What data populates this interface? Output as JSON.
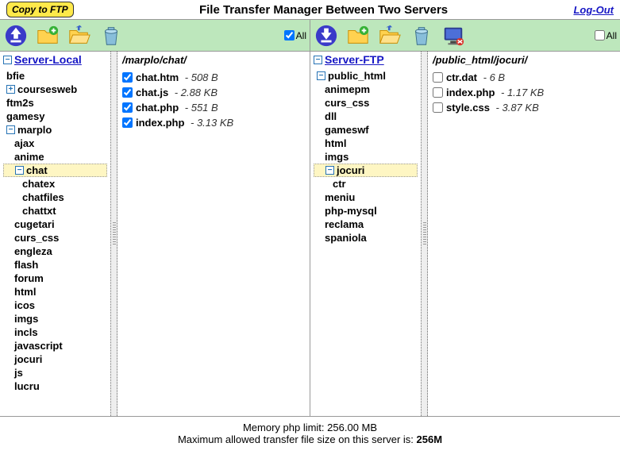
{
  "header": {
    "copy_label": "Copy to FTP",
    "title": "File Transfer Manager Between Two Servers",
    "logout": "Log-Out"
  },
  "all_label": "All",
  "panels": {
    "local": {
      "server_link": "Server-Local",
      "path": "/marplo/chat/",
      "all_checked": true,
      "tree": [
        {
          "label": "bfie",
          "lvl": 1,
          "t": null
        },
        {
          "label": "coursesweb",
          "lvl": 1,
          "t": "+"
        },
        {
          "label": "ftm2s",
          "lvl": 1,
          "t": null
        },
        {
          "label": "gamesy",
          "lvl": 1,
          "t": null
        },
        {
          "label": "marplo",
          "lvl": 1,
          "t": "-"
        },
        {
          "label": "ajax",
          "lvl": 2,
          "t": null
        },
        {
          "label": "anime",
          "lvl": 2,
          "t": null
        },
        {
          "label": "chat",
          "lvl": 2,
          "t": "-",
          "sel": true
        },
        {
          "label": "chatex",
          "lvl": 3,
          "t": null
        },
        {
          "label": "chatfiles",
          "lvl": 3,
          "t": null
        },
        {
          "label": "chattxt",
          "lvl": 3,
          "t": null
        },
        {
          "label": "cugetari",
          "lvl": 2,
          "t": null
        },
        {
          "label": "curs_css",
          "lvl": 2,
          "t": null
        },
        {
          "label": "engleza",
          "lvl": 2,
          "t": null
        },
        {
          "label": "flash",
          "lvl": 2,
          "t": null
        },
        {
          "label": "forum",
          "lvl": 2,
          "t": null
        },
        {
          "label": "html",
          "lvl": 2,
          "t": null
        },
        {
          "label": "icos",
          "lvl": 2,
          "t": null
        },
        {
          "label": "imgs",
          "lvl": 2,
          "t": null
        },
        {
          "label": "incls",
          "lvl": 2,
          "t": null
        },
        {
          "label": "javascript",
          "lvl": 2,
          "t": null
        },
        {
          "label": "jocuri",
          "lvl": 2,
          "t": null
        },
        {
          "label": "js",
          "lvl": 2,
          "t": null
        },
        {
          "label": "lucru",
          "lvl": 2,
          "t": null
        }
      ],
      "files": [
        {
          "name": "chat.htm",
          "size": "508 B",
          "checked": true
        },
        {
          "name": "chat.js",
          "size": "2.88 KB",
          "checked": true
        },
        {
          "name": "chat.php",
          "size": "551 B",
          "checked": true
        },
        {
          "name": "index.php",
          "size": "3.13 KB",
          "checked": true
        }
      ]
    },
    "ftp": {
      "server_link": "Server-FTP",
      "path": "/public_html/jocuri/",
      "all_checked": false,
      "tree": [
        {
          "label": "public_html",
          "lvl": 1,
          "t": "-"
        },
        {
          "label": "animepm",
          "lvl": 2,
          "t": null
        },
        {
          "label": "curs_css",
          "lvl": 2,
          "t": null
        },
        {
          "label": "dll",
          "lvl": 2,
          "t": null
        },
        {
          "label": "gameswf",
          "lvl": 2,
          "t": null
        },
        {
          "label": "html",
          "lvl": 2,
          "t": null
        },
        {
          "label": "imgs",
          "lvl": 2,
          "t": null
        },
        {
          "label": "jocuri",
          "lvl": 2,
          "t": "-",
          "sel": true
        },
        {
          "label": "ctr",
          "lvl": 3,
          "t": null
        },
        {
          "label": "meniu",
          "lvl": 2,
          "t": null
        },
        {
          "label": "php-mysql",
          "lvl": 2,
          "t": null
        },
        {
          "label": "reclama",
          "lvl": 2,
          "t": null
        },
        {
          "label": "spaniola",
          "lvl": 2,
          "t": null
        }
      ],
      "files": [
        {
          "name": "ctr.dat",
          "size": "6 B",
          "checked": false
        },
        {
          "name": "index.php",
          "size": "1.17 KB",
          "checked": false
        },
        {
          "name": "style.css",
          "size": "3.87 KB",
          "checked": false
        }
      ]
    }
  },
  "footer": {
    "line1_pre": "Memory php limit: ",
    "line1_val": "256.00 MB",
    "line2_pre": "Maximum allowed transfer file size on this server is: ",
    "line2_val": "256M"
  }
}
